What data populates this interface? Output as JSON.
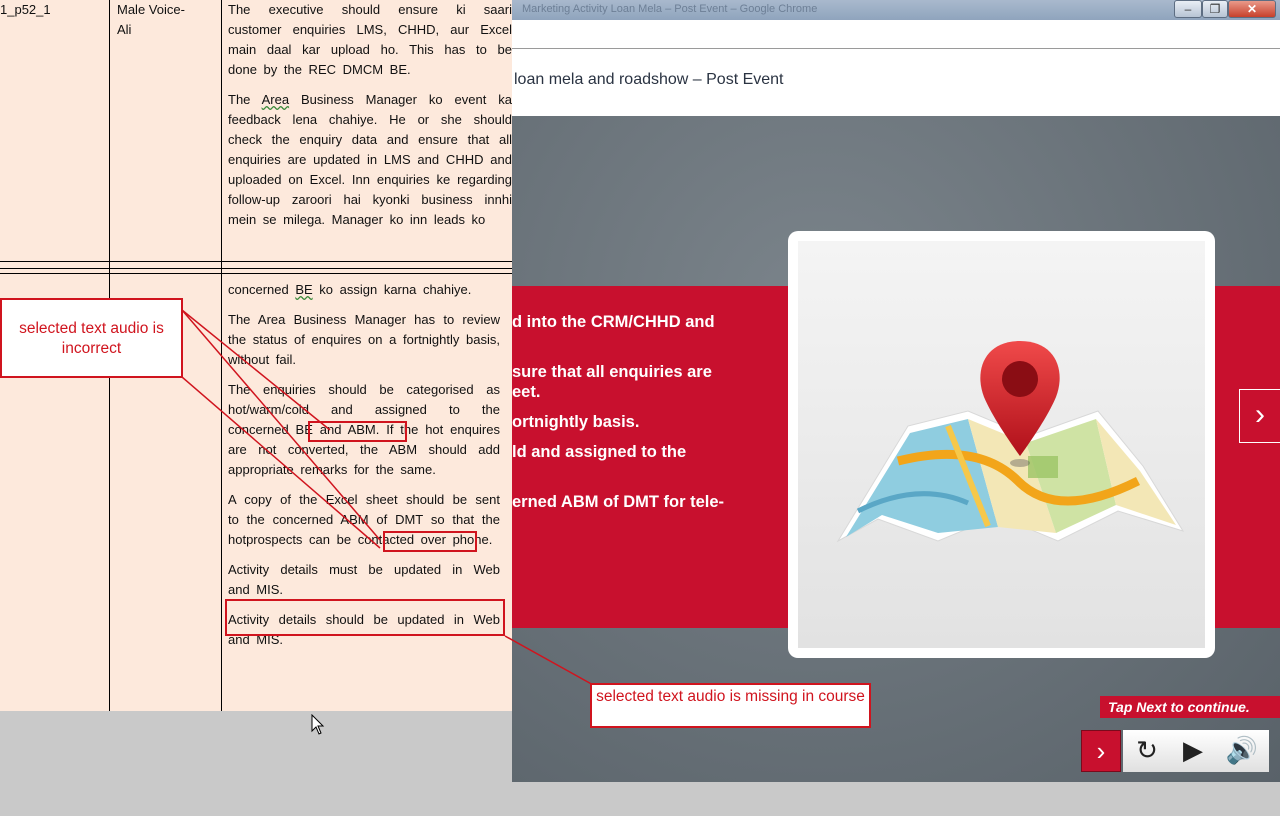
{
  "window": {
    "title": "Marketing Activity Loan Mela – Post Event – Google Chrome",
    "minimize": "–",
    "maximize": "❐",
    "close": "✕"
  },
  "course": {
    "title": "loan mela and roadshow – Post Event",
    "bullets": [
      "d into the CRM/CHHD and",
      "sure that all enquiries are",
      "eet.",
      "ortnightly basis.",
      "ld and assigned to the",
      "erned ABM of DMT for tele-"
    ],
    "side_next": "›",
    "tap_next": "Tap Next to continue.",
    "controls": {
      "next": "›",
      "replay": "↻",
      "play": "▶",
      "volume": "🔊"
    }
  },
  "doc": {
    "row1": {
      "id": "1_p52_1",
      "voice_line1": "Male Voice-",
      "voice_line2": "Ali",
      "p1": "The executive should ensure ki saari customer enquiries LMS, CHHD, aur Excel main daal kar upload ho. This has to be done by the REC DMCM BE.",
      "p2_prefix": "The ",
      "p2_wavy": "Area",
      "p2_rest": " Business Manager ko event ka feedback lena chahiye. He or she should check the enquiry data and ensure that all enquiries are updated in LMS and CHHD and uploaded on Excel. Inn enquiries ke regarding follow-up zaroori hai kyonki business innhi mein se milega. Manager ko inn leads ko"
    },
    "row2": {
      "p0_prefix": "concerned ",
      "p0_wavy": "BE",
      "p0_rest": " ko assign karna chahiye.",
      "p1": "The Area Business Manager has to review the status of enquires on a fortnightly basis, without fail.",
      "p2": "The enquiries should be categorised as hot/warm/cold and assigned to the concerned BE and ABM. If the hot enquires are not converted, the ABM should add appropriate remarks for the same.",
      "p3": "A copy of the Excel sheet should be sent to the concerned ABM of DMT so that the hotprospects can be contacted over phone.",
      "p4": "Activity details must be updated in Web and MIS.",
      "p5": "Activity details should be updated in Web and MIS."
    }
  },
  "annotations": {
    "incorrect": "selected text audio is incorrect",
    "missing": "selected text audio is missing in course",
    "color": "#d0141e"
  }
}
